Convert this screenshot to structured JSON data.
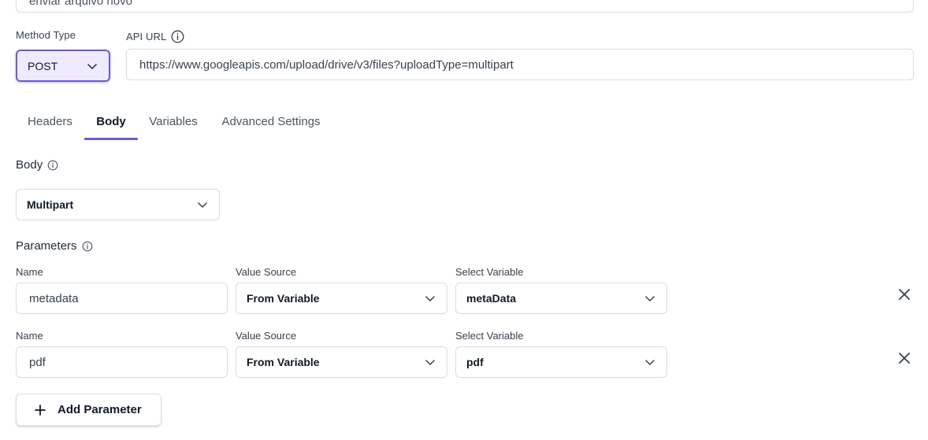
{
  "request_name": {
    "value": "enviar arquivo novo"
  },
  "method": {
    "label": "Method Type",
    "value": "POST"
  },
  "api_url": {
    "label": "API URL",
    "value": "https://www.googleapis.com/upload/drive/v3/files?uploadType=multipart"
  },
  "tabs": [
    {
      "label": "Headers",
      "active": false
    },
    {
      "label": "Body",
      "active": true
    },
    {
      "label": "Variables",
      "active": false
    },
    {
      "label": "Advanced Settings",
      "active": false
    }
  ],
  "body": {
    "title": "Body",
    "type_value": "Multipart"
  },
  "parameters": {
    "title": "Parameters",
    "rows": [
      {
        "name_label": "Name",
        "name_value": "metadata",
        "source_label": "Value Source",
        "source_value": "From Variable",
        "variable_label": "Select Variable",
        "variable_value": "metaData"
      },
      {
        "name_label": "Name",
        "name_value": "pdf",
        "source_label": "Value Source",
        "source_value": "From Variable",
        "variable_label": "Select Variable",
        "variable_value": "pdf"
      }
    ],
    "add_label": "Add Parameter"
  },
  "icons": {
    "info": "info-icon",
    "chevron": "chevron-down-icon",
    "close": "close-icon",
    "plus": "plus-icon"
  },
  "colors": {
    "accent": "#6d5bd0",
    "accent_bg": "#efeaff",
    "border": "#d9dce1"
  }
}
